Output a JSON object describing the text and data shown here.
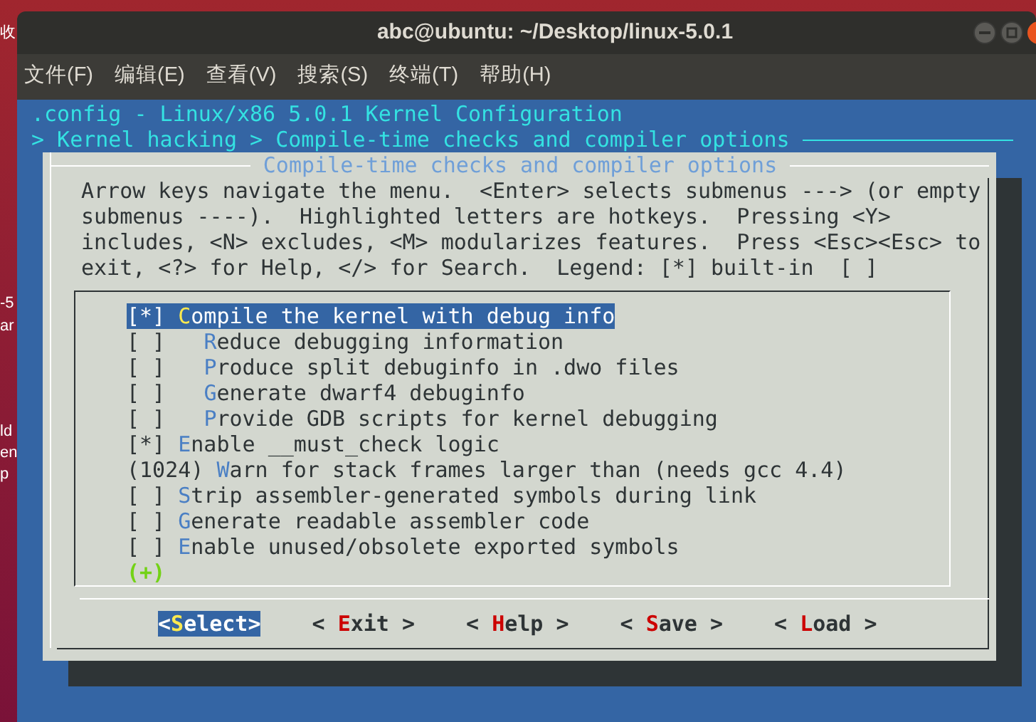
{
  "desktop": {
    "fragments": [
      "收",
      "-5",
      "ar",
      "ld",
      "en",
      "p"
    ]
  },
  "window": {
    "title": "abc@ubuntu: ~/Desktop/linux-5.0.1"
  },
  "menu": [
    "文件(F)",
    "编辑(E)",
    "查看(V)",
    "搜索(S)",
    "终端(T)",
    "帮助(H)"
  ],
  "terminal": {
    "header": ".config - Linux/x86 5.0.1 Kernel Configuration",
    "breadcrumb": "> Kernel hacking > Compile-time checks and compiler options"
  },
  "dialog": {
    "title": "Compile-time checks and compiler options",
    "help_lines": [
      "Arrow keys navigate the menu.  <Enter> selects submenus ---> (or empty",
      "submenus ----).  Highlighted letters are hotkeys.  Pressing <Y>",
      "includes, <N> excludes, <M> modularizes features.  Press <Esc><Esc> to",
      "exit, <?> for Help, </> for Search.  Legend: [*] built-in  [ ]"
    ],
    "items": [
      {
        "prefix": "[*]",
        "key": "C",
        "rest": "ompile the kernel with debug info",
        "selected": true,
        "children": [
          {
            "prefix": "[ ]",
            "key": "R",
            "rest": "educe debugging information",
            "selected": false
          },
          {
            "prefix": "[ ]",
            "key": "P",
            "rest": "roduce split debuginfo in .dwo files",
            "selected": false
          },
          {
            "prefix": "[ ]",
            "key": "G",
            "rest": "enerate dwarf4 debuginfo",
            "selected": false
          },
          {
            "prefix": "[ ]",
            "key": "P",
            "rest": "rovide GDB scripts for kernel debugging",
            "selected": false
          }
        ]
      },
      {
        "prefix": "[*]",
        "key": "E",
        "rest": "nable __must_check logic",
        "selected": false
      },
      {
        "prefix": "(1024)",
        "key": "W",
        "rest": "arn for stack frames larger than (needs gcc 4.4)",
        "selected": false
      },
      {
        "prefix": "[ ]",
        "key": "S",
        "rest": "trip assembler-generated symbols during link",
        "selected": false
      },
      {
        "prefix": "[ ]",
        "key": "G",
        "rest": "enerate readable assembler code",
        "selected": false
      },
      {
        "prefix": "[ ]",
        "key": "E",
        "rest": "nable unused/obsolete exported symbols",
        "selected": false
      }
    ],
    "more_indicator": "(+)",
    "buttons": [
      {
        "before": "<",
        "key": "S",
        "after": "elect>",
        "selected": true
      },
      {
        "before": "< ",
        "key": "E",
        "after": "xit >",
        "selected": false
      },
      {
        "before": "< ",
        "key": "H",
        "after": "elp >",
        "selected": false
      },
      {
        "before": "< ",
        "key": "S",
        "after": "ave >",
        "selected": false
      },
      {
        "before": "< ",
        "key": "L",
        "after": "oad >",
        "selected": false
      }
    ]
  }
}
